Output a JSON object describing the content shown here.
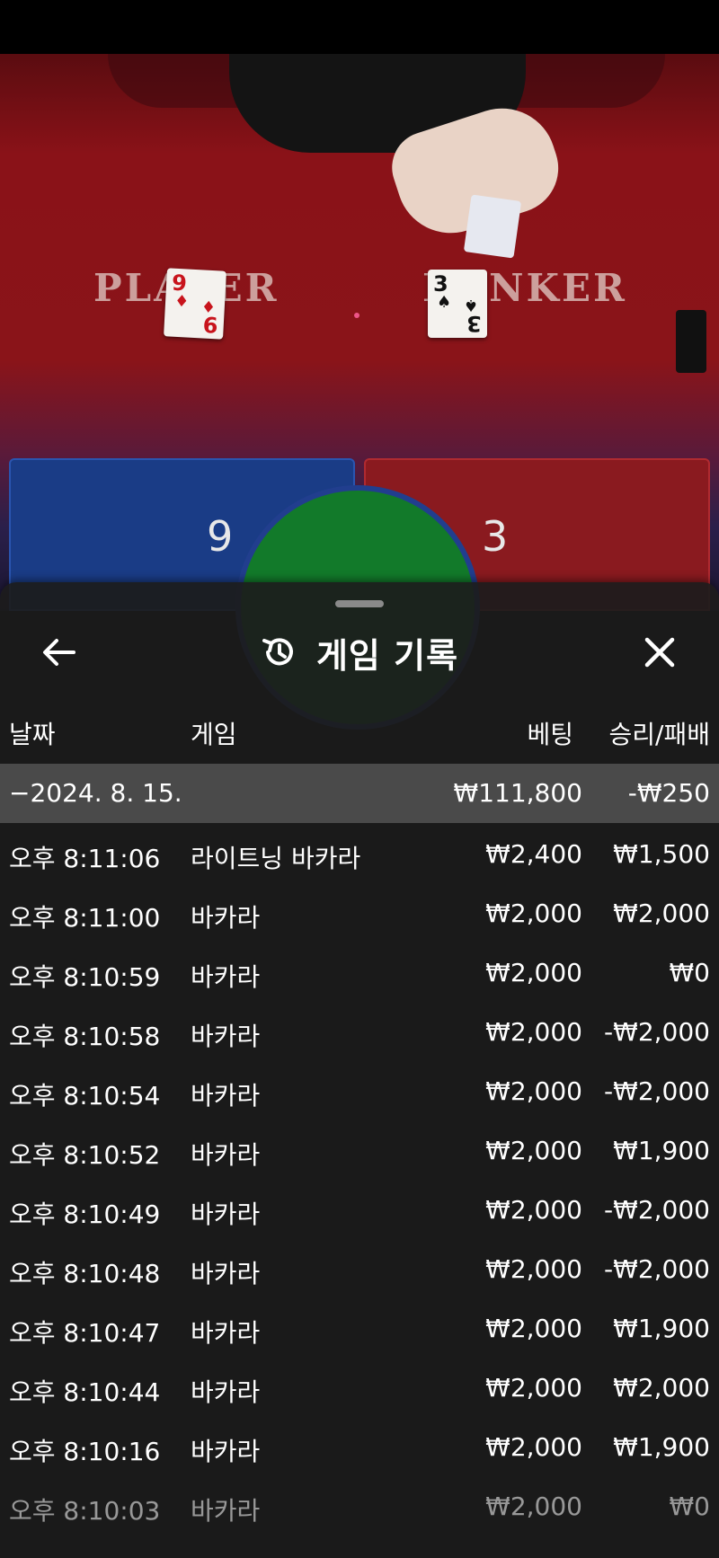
{
  "game_view": {
    "table_labels": {
      "player": "PLAYER",
      "banker": "BANKER"
    },
    "cards": {
      "player": {
        "rank": "9",
        "suit": "♦"
      },
      "banker": {
        "rank": "3",
        "suit": "♠"
      }
    },
    "scores": {
      "player": "9",
      "banker": "3"
    }
  },
  "sheet": {
    "title": "게임 기록",
    "icons": {
      "back": "arrow-left-icon",
      "history": "history-icon",
      "close": "close-icon"
    },
    "columns": {
      "date": "날짜",
      "game": "게임",
      "bet": "베팅",
      "result": "승리/패배"
    },
    "summary": {
      "date": "−2024. 8. 15.",
      "bet": "₩111,800",
      "result": "-₩250"
    },
    "rows": [
      {
        "time": "오후 8:11:06",
        "game": "라이트닝 바카라",
        "bet": "₩2,400",
        "result": "₩1,500"
      },
      {
        "time": "오후 8:11:00",
        "game": "바카라",
        "bet": "₩2,000",
        "result": "₩2,000"
      },
      {
        "time": "오후 8:10:59",
        "game": "바카라",
        "bet": "₩2,000",
        "result": "₩0"
      },
      {
        "time": "오후 8:10:58",
        "game": "바카라",
        "bet": "₩2,000",
        "result": "-₩2,000"
      },
      {
        "time": "오후 8:10:54",
        "game": "바카라",
        "bet": "₩2,000",
        "result": "-₩2,000"
      },
      {
        "time": "오후 8:10:52",
        "game": "바카라",
        "bet": "₩2,000",
        "result": "₩1,900"
      },
      {
        "time": "오후 8:10:49",
        "game": "바카라",
        "bet": "₩2,000",
        "result": "-₩2,000"
      },
      {
        "time": "오후 8:10:48",
        "game": "바카라",
        "bet": "₩2,000",
        "result": "-₩2,000"
      },
      {
        "time": "오후 8:10:47",
        "game": "바카라",
        "bet": "₩2,000",
        "result": "₩1,900"
      },
      {
        "time": "오후 8:10:44",
        "game": "바카라",
        "bet": "₩2,000",
        "result": "₩2,000"
      },
      {
        "time": "오후 8:10:16",
        "game": "바카라",
        "bet": "₩2,000",
        "result": "₩1,900"
      },
      {
        "time": "오후 8:10:03",
        "game": "바카라",
        "bet": "₩2,000",
        "result": "₩0"
      }
    ]
  },
  "colors": {
    "sheet_bg": "#1c1c1c",
    "summary_bg": "#4a4a4a",
    "table_red": "#8a1218",
    "player_blue": "#1a3c86",
    "tie_green": "#127a2a"
  }
}
